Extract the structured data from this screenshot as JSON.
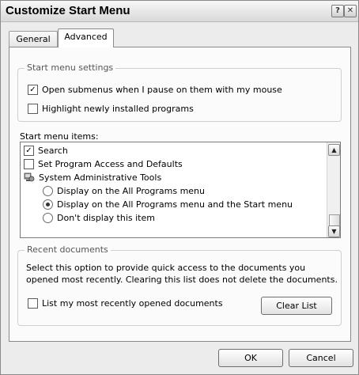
{
  "window": {
    "title": "Customize Start Menu",
    "help_glyph": "?",
    "close_glyph": "✕"
  },
  "tabs": [
    {
      "label": "General",
      "selected": false
    },
    {
      "label": "Advanced",
      "selected": true
    }
  ],
  "start_menu_settings": {
    "legend": "Start menu settings",
    "options": [
      {
        "label": "Open submenus when I pause on them with my mouse",
        "checked": true
      },
      {
        "label": "Highlight newly installed programs",
        "checked": false
      }
    ]
  },
  "start_menu_items": {
    "label": "Start menu items:",
    "items": [
      {
        "kind": "checkbox",
        "label": "Search",
        "checked": true
      },
      {
        "kind": "checkbox",
        "label": "Set Program Access and Defaults",
        "checked": false
      },
      {
        "kind": "folder",
        "label": "System Administrative Tools",
        "icon": "admin-tools-icon"
      },
      {
        "kind": "radio",
        "label": "Display on the All Programs menu",
        "selected": false
      },
      {
        "kind": "radio",
        "label": "Display on the All Programs menu and the Start menu",
        "selected": true
      },
      {
        "kind": "radio",
        "label": "Don't display this item",
        "selected": false
      }
    ],
    "scroll_up_glyph": "▲",
    "scroll_down_glyph": "▼"
  },
  "recent_documents": {
    "legend": "Recent documents",
    "description": "Select this option to provide quick access to the documents you opened most recently.  Clearing this list does not delete the documents.",
    "list_recent_label": "List my most recently opened documents",
    "list_recent_checked": false,
    "clear_button": "Clear List"
  },
  "footer": {
    "ok": "OK",
    "cancel": "Cancel"
  }
}
